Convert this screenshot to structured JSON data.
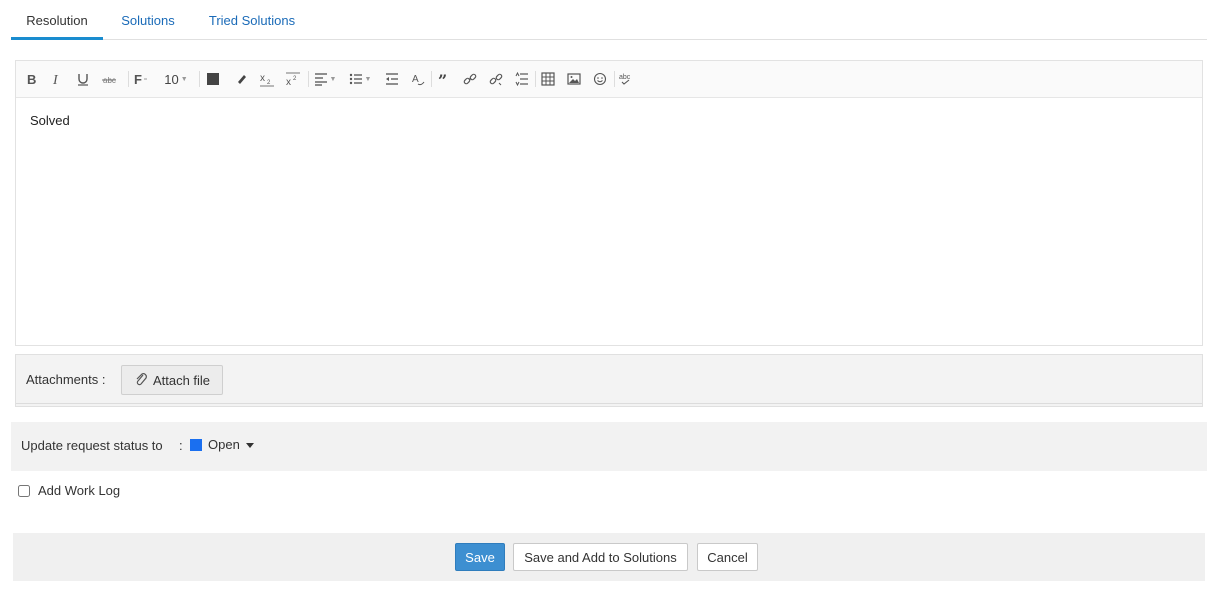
{
  "tabs": [
    {
      "label": "Resolution",
      "active": true
    },
    {
      "label": "Solutions",
      "active": false
    },
    {
      "label": "Tried Solutions",
      "active": false
    }
  ],
  "toolbar": {
    "font_size": "10",
    "icons": [
      "bold-icon",
      "italic-icon",
      "underline-icon",
      "strikethrough-icon",
      "font-family-icon",
      "font-size-select",
      "text-color-icon",
      "highlight-icon",
      "subscript-icon",
      "superscript-icon",
      "align-icon",
      "bullet-list-icon",
      "outdent-icon",
      "clear-format-icon",
      "quote-icon",
      "link-icon",
      "unlink-icon",
      "line-spacing-icon",
      "table-icon",
      "image-icon",
      "emoji-icon",
      "spellcheck-icon"
    ]
  },
  "editor": {
    "content": "Solved"
  },
  "attachments": {
    "label": "Attachments :",
    "button_label": "Attach file"
  },
  "status": {
    "label": "Update request status to",
    "colon": ":",
    "value": "Open",
    "color": "#1a6ff0"
  },
  "worklog": {
    "label": "Add Work Log",
    "checked": false
  },
  "footer": {
    "save_label": "Save",
    "save_add_label": "Save and Add to Solutions",
    "cancel_label": "Cancel"
  },
  "colors": {
    "accent": "#1a8ccf",
    "primary_button": "#3d8fd1",
    "link": "#1b6bb8"
  }
}
